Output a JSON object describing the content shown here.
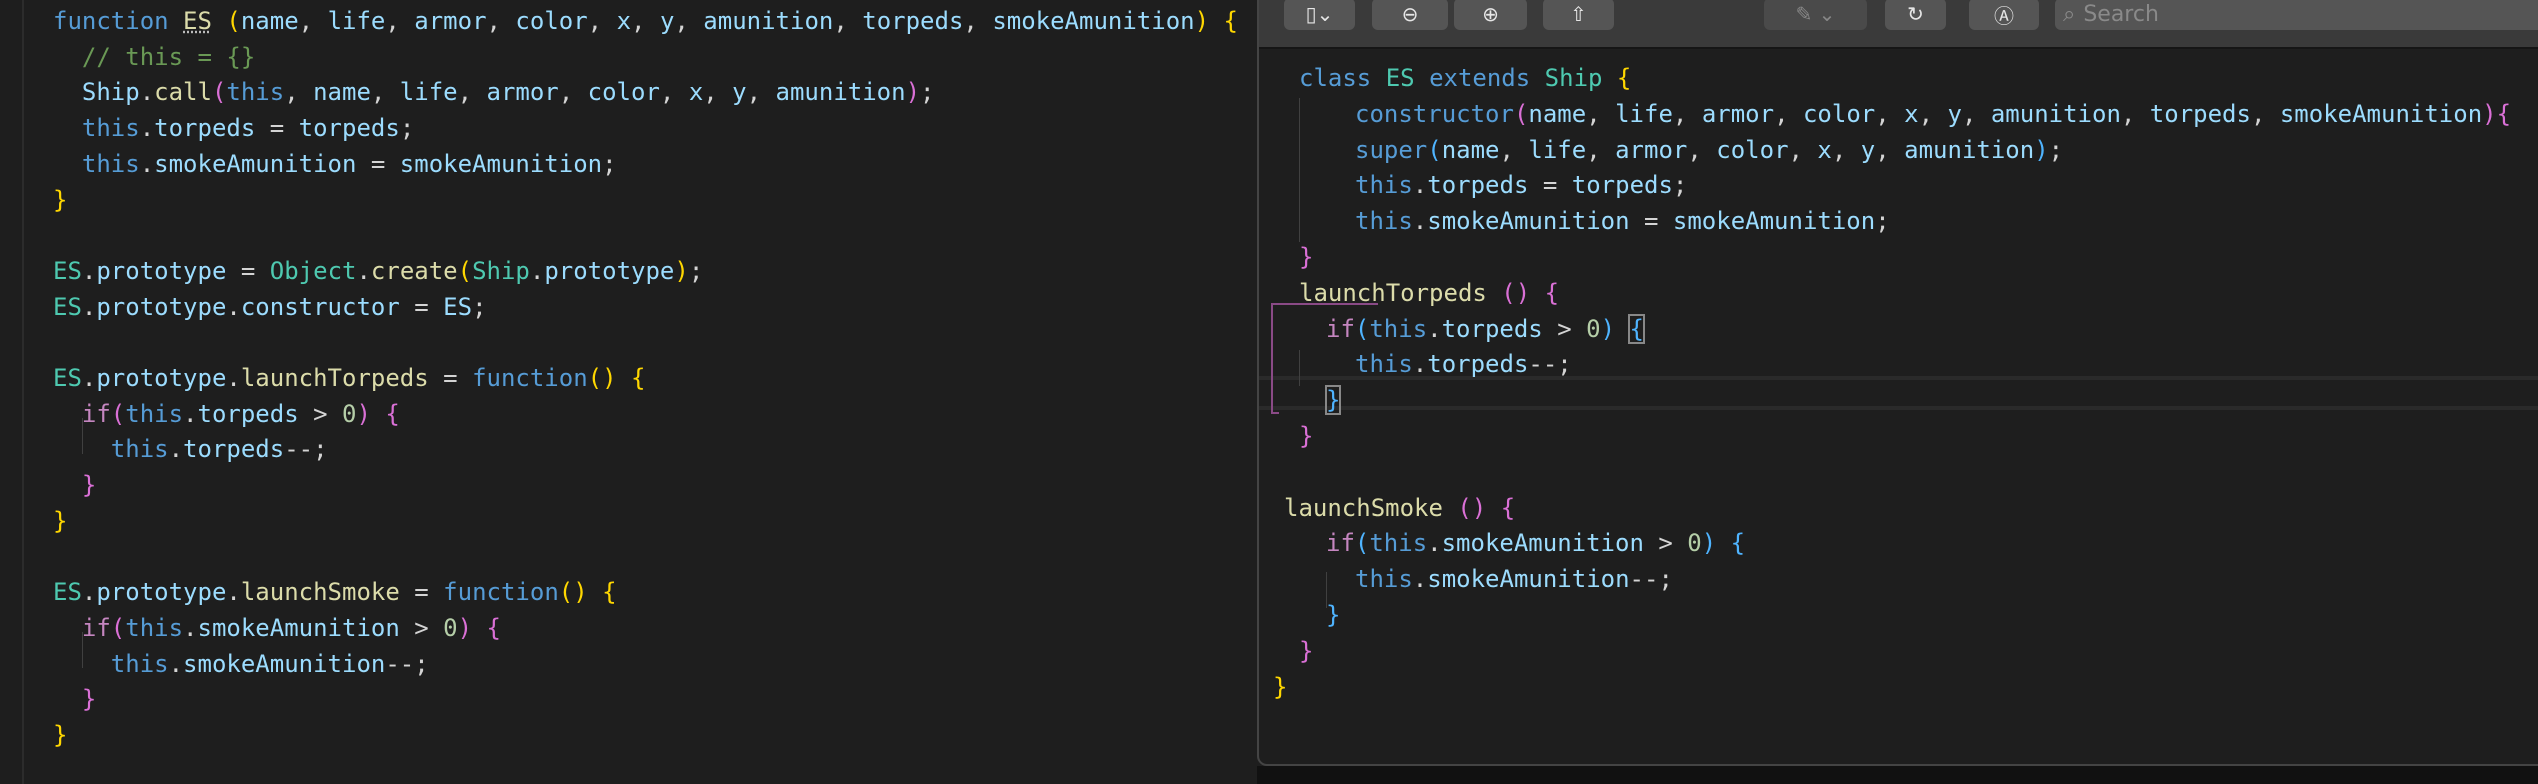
{
  "left_editor": {
    "lines": [
      [
        [
          "function",
          "kw"
        ],
        [
          " ",
          "p"
        ],
        [
          "ES",
          "fn ul"
        ],
        [
          " ",
          "p"
        ],
        [
          "(",
          "b1"
        ],
        [
          "name",
          "var"
        ],
        [
          ", ",
          "p"
        ],
        [
          "life",
          "var"
        ],
        [
          ", ",
          "p"
        ],
        [
          "armor",
          "var"
        ],
        [
          ", ",
          "p"
        ],
        [
          "color",
          "var"
        ],
        [
          ", ",
          "p"
        ],
        [
          "x",
          "var"
        ],
        [
          ", ",
          "p"
        ],
        [
          "y",
          "var"
        ],
        [
          ", ",
          "p"
        ],
        [
          "amunition",
          "var"
        ],
        [
          ", ",
          "p"
        ],
        [
          "torpeds",
          "var"
        ],
        [
          ", ",
          "p"
        ],
        [
          "smokeAmunition",
          "var"
        ],
        [
          ")",
          "b1"
        ],
        [
          " ",
          "p"
        ],
        [
          "{",
          "b1"
        ]
      ],
      [
        [
          "// this = {}",
          "cm"
        ]
      ],
      [
        [
          "Ship",
          "var"
        ],
        [
          ".",
          "p"
        ],
        [
          "call",
          "fn"
        ],
        [
          "(",
          "b2"
        ],
        [
          "this",
          "kw"
        ],
        [
          ", ",
          "p"
        ],
        [
          "name",
          "var"
        ],
        [
          ", ",
          "p"
        ],
        [
          "life",
          "var"
        ],
        [
          ", ",
          "p"
        ],
        [
          "armor",
          "var"
        ],
        [
          ", ",
          "p"
        ],
        [
          "color",
          "var"
        ],
        [
          ", ",
          "p"
        ],
        [
          "x",
          "var"
        ],
        [
          ", ",
          "p"
        ],
        [
          "y",
          "var"
        ],
        [
          ", ",
          "p"
        ],
        [
          "amunition",
          "var"
        ],
        [
          ")",
          "b2"
        ],
        [
          ";",
          "p"
        ]
      ],
      [
        [
          "this",
          "kw"
        ],
        [
          ".",
          "p"
        ],
        [
          "torpeds",
          "var"
        ],
        [
          " = ",
          "p"
        ],
        [
          "torpeds",
          "var"
        ],
        [
          ";",
          "p"
        ]
      ],
      [
        [
          "this",
          "kw"
        ],
        [
          ".",
          "p"
        ],
        [
          "smokeAmunition",
          "var"
        ],
        [
          " = ",
          "p"
        ],
        [
          "smokeAmunition",
          "var"
        ],
        [
          ";",
          "p"
        ]
      ],
      [
        [
          "}",
          "b1"
        ]
      ],
      [],
      [
        [
          "ES",
          "cls"
        ],
        [
          ".",
          "p"
        ],
        [
          "prototype",
          "var"
        ],
        [
          " = ",
          "p"
        ],
        [
          "Object",
          "cls"
        ],
        [
          ".",
          "p"
        ],
        [
          "create",
          "fn"
        ],
        [
          "(",
          "b1"
        ],
        [
          "Ship",
          "cls"
        ],
        [
          ".",
          "p"
        ],
        [
          "prototype",
          "var"
        ],
        [
          ")",
          "b1"
        ],
        [
          ";",
          "p"
        ]
      ],
      [
        [
          "ES",
          "cls"
        ],
        [
          ".",
          "p"
        ],
        [
          "prototype",
          "var"
        ],
        [
          ".",
          "p"
        ],
        [
          "constructor",
          "var"
        ],
        [
          " = ",
          "p"
        ],
        [
          "ES",
          "var"
        ],
        [
          ";",
          "p"
        ]
      ],
      [],
      [
        [
          "ES",
          "cls"
        ],
        [
          ".",
          "p"
        ],
        [
          "prototype",
          "var"
        ],
        [
          ".",
          "p"
        ],
        [
          "launchTorpeds",
          "fn"
        ],
        [
          " = ",
          "p"
        ],
        [
          "function",
          "kw"
        ],
        [
          "()",
          "b1"
        ],
        [
          " ",
          "p"
        ],
        [
          "{",
          "b1"
        ]
      ],
      [
        [
          "if",
          "ctl"
        ],
        [
          "(",
          "b2"
        ],
        [
          "this",
          "kw"
        ],
        [
          ".",
          "p"
        ],
        [
          "torpeds",
          "var"
        ],
        [
          " > ",
          "p"
        ],
        [
          "0",
          "num"
        ],
        [
          ")",
          "b2"
        ],
        [
          " ",
          "p"
        ],
        [
          "{",
          "b2"
        ]
      ],
      [
        [
          "this",
          "kw"
        ],
        [
          ".",
          "p"
        ],
        [
          "torpeds",
          "var"
        ],
        [
          "--;",
          "p"
        ]
      ],
      [
        [
          "}",
          "b2"
        ]
      ],
      [
        [
          "}",
          "b1"
        ]
      ],
      [],
      [
        [
          "ES",
          "cls"
        ],
        [
          ".",
          "p"
        ],
        [
          "prototype",
          "var"
        ],
        [
          ".",
          "p"
        ],
        [
          "launchSmoke",
          "fn"
        ],
        [
          " = ",
          "p"
        ],
        [
          "function",
          "kw"
        ],
        [
          "()",
          "b1"
        ],
        [
          " ",
          "p"
        ],
        [
          "{",
          "b1"
        ]
      ],
      [
        [
          "if",
          "ctl"
        ],
        [
          "(",
          "b2"
        ],
        [
          "this",
          "kw"
        ],
        [
          ".",
          "p"
        ],
        [
          "smokeAmunition",
          "var"
        ],
        [
          " > ",
          "p"
        ],
        [
          "0",
          "num"
        ],
        [
          ")",
          "b2"
        ],
        [
          " ",
          "p"
        ],
        [
          "{",
          "b2"
        ]
      ],
      [
        [
          "this",
          "kw"
        ],
        [
          ".",
          "p"
        ],
        [
          "smokeAmunition",
          "var"
        ],
        [
          "--;",
          "p"
        ]
      ],
      [
        [
          "}",
          "b2"
        ]
      ],
      [
        [
          "}",
          "b1"
        ]
      ]
    ]
  },
  "viewer": {
    "toolbar": {
      "sidebar_icon": "sidebar-toggle-icon",
      "zoom_out_icon": "zoom-out-icon",
      "zoom_in_icon": "zoom-in-icon",
      "share_icon": "share-icon",
      "markup_icon": "highlighter-icon",
      "rotate_icon": "rotate-icon",
      "annotate_icon": "markup-pen-icon",
      "search_placeholder": "Search"
    },
    "lines": [
      [
        [
          "class",
          "kw"
        ],
        [
          " ",
          "p"
        ],
        [
          "ES",
          "cls"
        ],
        [
          " ",
          "p"
        ],
        [
          "extends",
          "kw"
        ],
        [
          " ",
          "p"
        ],
        [
          "Ship",
          "cls"
        ],
        [
          " ",
          "p"
        ],
        [
          "{",
          "b1"
        ]
      ],
      [
        [
          "constructor",
          "kw"
        ],
        [
          "(",
          "b2"
        ],
        [
          "name",
          "var"
        ],
        [
          ", ",
          "p"
        ],
        [
          "life",
          "var"
        ],
        [
          ", ",
          "p"
        ],
        [
          "armor",
          "var"
        ],
        [
          ", ",
          "p"
        ],
        [
          "color",
          "var"
        ],
        [
          ", ",
          "p"
        ],
        [
          "x",
          "var"
        ],
        [
          ", ",
          "p"
        ],
        [
          "y",
          "var"
        ],
        [
          ", ",
          "p"
        ],
        [
          "amunition",
          "var"
        ],
        [
          ", ",
          "p"
        ],
        [
          "torpeds",
          "var"
        ],
        [
          ", ",
          "p"
        ],
        [
          "smokeAmunition",
          "var"
        ],
        [
          ")",
          "b2"
        ],
        [
          "{",
          "b2"
        ]
      ],
      [
        [
          "super",
          "kw"
        ],
        [
          "(",
          "b3"
        ],
        [
          "name",
          "var"
        ],
        [
          ", ",
          "p"
        ],
        [
          "life",
          "var"
        ],
        [
          ", ",
          "p"
        ],
        [
          "armor",
          "var"
        ],
        [
          ", ",
          "p"
        ],
        [
          "color",
          "var"
        ],
        [
          ", ",
          "p"
        ],
        [
          "x",
          "var"
        ],
        [
          ", ",
          "p"
        ],
        [
          "y",
          "var"
        ],
        [
          ", ",
          "p"
        ],
        [
          "amunition",
          "var"
        ],
        [
          ")",
          "b3"
        ],
        [
          ";",
          "p"
        ]
      ],
      [
        [
          "this",
          "kw"
        ],
        [
          ".",
          "p"
        ],
        [
          "torpeds",
          "var"
        ],
        [
          " = ",
          "p"
        ],
        [
          "torpeds",
          "var"
        ],
        [
          ";",
          "p"
        ]
      ],
      [
        [
          "this",
          "kw"
        ],
        [
          ".",
          "p"
        ],
        [
          "smokeAmunition",
          "var"
        ],
        [
          " = ",
          "p"
        ],
        [
          "smokeAmunition",
          "var"
        ],
        [
          ";",
          "p"
        ]
      ],
      [
        [
          "}",
          "b2"
        ]
      ],
      [
        [
          "launchTorpeds",
          "fn"
        ],
        [
          " ",
          "p"
        ],
        [
          "()",
          "b2"
        ],
        [
          " ",
          "p"
        ],
        [
          "{",
          "b2"
        ]
      ],
      [
        [
          "if",
          "ctl"
        ],
        [
          "(",
          "b3"
        ],
        [
          "this",
          "kw"
        ],
        [
          ".",
          "p"
        ],
        [
          "torpeds",
          "var"
        ],
        [
          " > ",
          "p"
        ],
        [
          "0",
          "num"
        ],
        [
          ")",
          "b3"
        ],
        [
          " ",
          "p"
        ],
        [
          "{",
          "b3 boxed"
        ]
      ],
      [
        [
          "this",
          "kw"
        ],
        [
          ".",
          "p"
        ],
        [
          "torpeds",
          "var"
        ],
        [
          "--;",
          "p"
        ]
      ],
      [
        [
          "}",
          "b3 boxed"
        ]
      ],
      [
        [
          "}",
          "b2"
        ]
      ],
      [],
      [
        [
          "launchSmoke",
          "fn"
        ],
        [
          " ",
          "p"
        ],
        [
          "()",
          "b2"
        ],
        [
          " ",
          "p"
        ],
        [
          "{",
          "b2"
        ]
      ],
      [
        [
          "if",
          "ctl"
        ],
        [
          "(",
          "b3"
        ],
        [
          "this",
          "kw"
        ],
        [
          ".",
          "p"
        ],
        [
          "smokeAmunition",
          "var"
        ],
        [
          " > ",
          "p"
        ],
        [
          "0",
          "num"
        ],
        [
          ")",
          "b3"
        ],
        [
          " ",
          "p"
        ],
        [
          "{",
          "b3"
        ]
      ],
      [
        [
          "this",
          "kw"
        ],
        [
          ".",
          "p"
        ],
        [
          "smokeAmunition",
          "var"
        ],
        [
          "--;",
          "p"
        ]
      ],
      [
        [
          "}",
          "b3"
        ]
      ],
      [
        [
          "}",
          "b2"
        ]
      ],
      [
        [
          "}",
          "b1"
        ]
      ]
    ]
  },
  "colors": {
    "background": "#1e1e1e",
    "keyword": "#569cd6",
    "variable": "#9cdcfe",
    "class": "#4ec9b0",
    "function": "#dcdcaa",
    "bracket_gold": "#ffd700",
    "bracket_pink": "#da70d6",
    "comment": "#6a9955"
  }
}
